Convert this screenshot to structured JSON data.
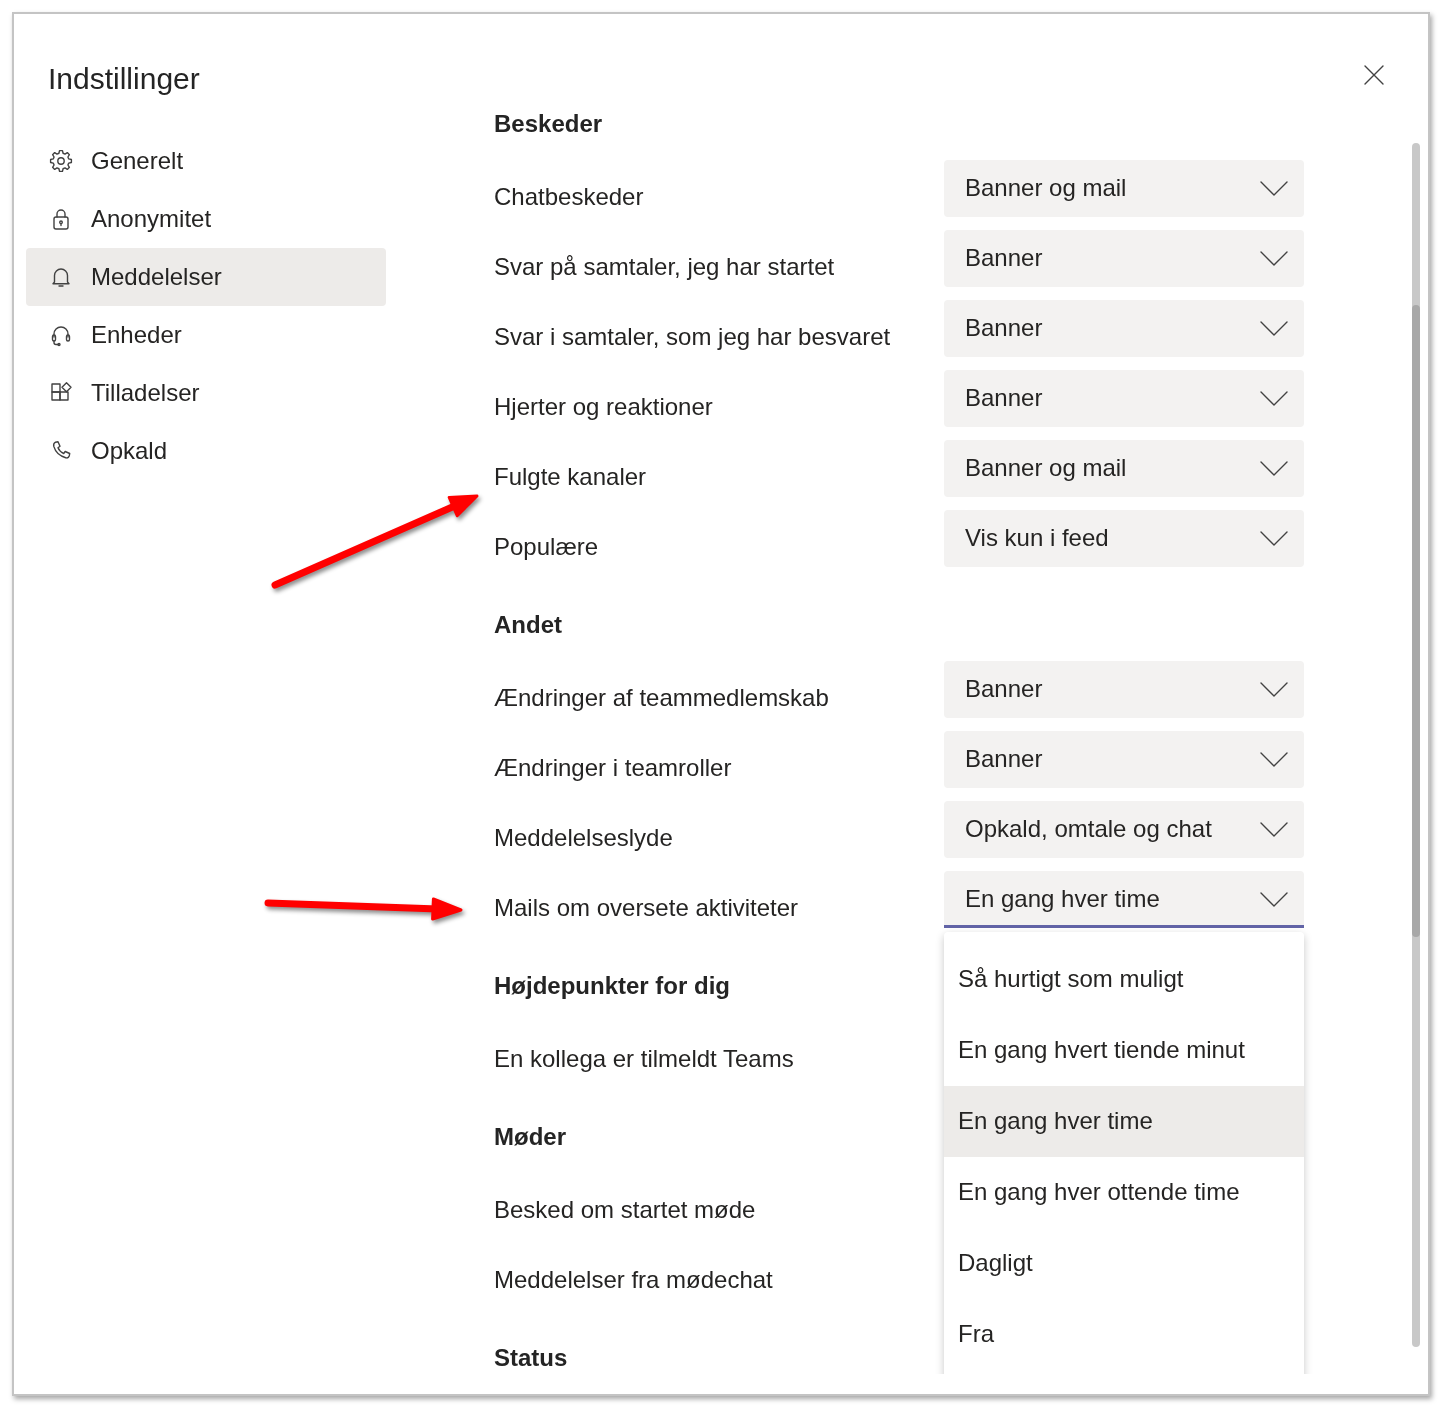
{
  "window": {
    "title": "Indstillinger"
  },
  "sidebar": {
    "items": [
      {
        "label": "Generelt",
        "selected": false
      },
      {
        "label": "Anonymitet",
        "selected": false
      },
      {
        "label": "Meddelelser",
        "selected": true
      },
      {
        "label": "Enheder",
        "selected": false
      },
      {
        "label": "Tilladelser",
        "selected": false
      },
      {
        "label": "Opkald",
        "selected": false
      }
    ]
  },
  "sections": [
    {
      "heading": "Beskeder",
      "rows": [
        {
          "label": "Chatbeskeder",
          "value": "Banner og mail",
          "expanded": false
        },
        {
          "label": "Svar på samtaler, jeg har startet",
          "value": "Banner",
          "expanded": false
        },
        {
          "label": "Svar i samtaler, som jeg har besvaret",
          "value": "Banner",
          "expanded": false
        },
        {
          "label": "Hjerter og reaktioner",
          "value": "Banner",
          "expanded": false
        },
        {
          "label": "Fulgte kanaler",
          "value": "Banner og mail",
          "expanded": false
        },
        {
          "label": "Populære",
          "value": "Vis kun i feed",
          "expanded": false
        }
      ]
    },
    {
      "heading": "Andet",
      "rows": [
        {
          "label": "Ændringer af teammedlemskab",
          "value": "Banner",
          "expanded": false
        },
        {
          "label": "Ændringer i teamroller",
          "value": "Banner",
          "expanded": false
        },
        {
          "label": "Meddelelseslyde",
          "value": "Opkald, omtale og chat",
          "expanded": false
        },
        {
          "label": "Mails om oversete aktiviteter",
          "value": "En gang hver time",
          "expanded": true,
          "options": [
            {
              "label": "Så hurtigt som muligt",
              "selected": false
            },
            {
              "label": "En gang hvert tiende minut",
              "selected": false
            },
            {
              "label": "En gang hver time",
              "selected": true
            },
            {
              "label": "En gang hver ottende time",
              "selected": false
            },
            {
              "label": "Dagligt",
              "selected": false
            },
            {
              "label": "Fra",
              "selected": false
            }
          ]
        }
      ]
    },
    {
      "heading": "Højdepunkter for dig",
      "rows": [
        {
          "label": "En kollega er tilmeldt Teams"
        }
      ]
    },
    {
      "heading": "Møder",
      "rows": [
        {
          "label": "Besked om startet møde"
        },
        {
          "label": "Meddelelser fra mødechat"
        }
      ]
    },
    {
      "heading": "Status"
    }
  ]
}
